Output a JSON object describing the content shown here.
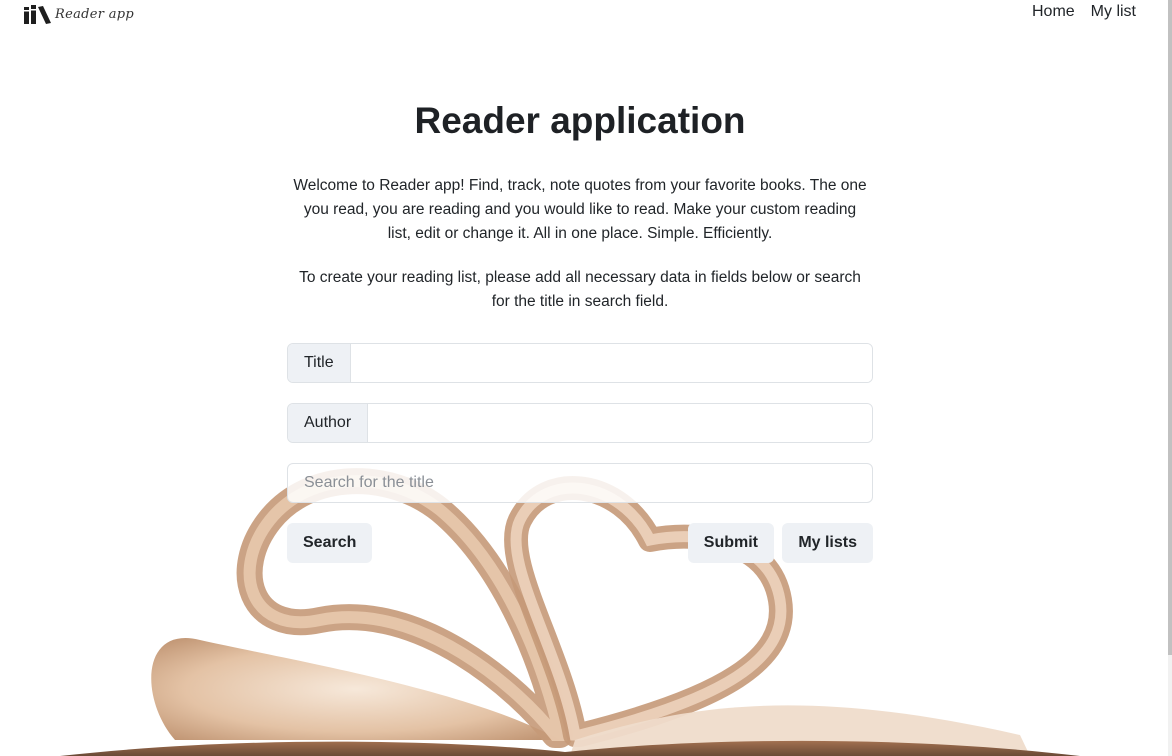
{
  "navbar": {
    "brand_text": "Reader app",
    "links": [
      {
        "label": "Home"
      },
      {
        "label": "My list"
      }
    ]
  },
  "main": {
    "title": "Reader application",
    "intro_paragraphs": [
      "Welcome to Reader app! Find, track, note quotes from your favorite books. The one you read, you are reading and you would like to read. Make your custom reading list, edit or change it. All in one place. Simple. Efficiently.",
      "To create your reading list, please add all necessary data in fields below or search for the title in search field."
    ]
  },
  "form": {
    "title_label": "Title",
    "title_value": "",
    "author_label": "Author",
    "author_value": "",
    "search_placeholder": "Search for the title",
    "search_value": "",
    "buttons": {
      "search": "Search",
      "submit": "Submit",
      "my_lists": "My lists"
    }
  },
  "icons": {
    "brand_logo": "books-logo-icon"
  },
  "colors": {
    "text": "#212529",
    "button_bg": "#eef1f5",
    "border": "#dee2e6",
    "page_tone": "#e8c9ad"
  }
}
